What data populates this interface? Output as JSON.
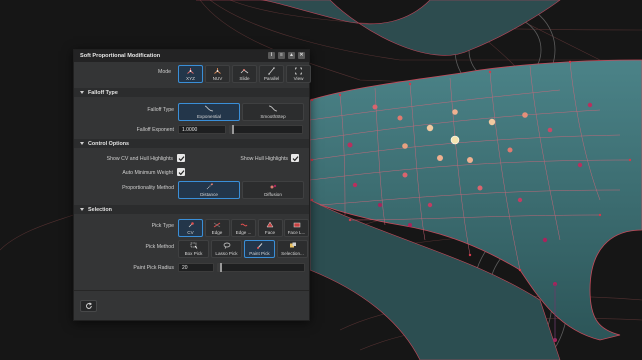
{
  "panel": {
    "title": "Soft Proportional Modification",
    "title_icons": [
      "info-icon",
      "menu-icon",
      "warning-icon",
      "close-icon"
    ]
  },
  "mode": {
    "label": "Mode",
    "options": [
      {
        "label": "XYZ",
        "icon": "xyz-axes-icon",
        "selected": true
      },
      {
        "label": "NUV",
        "icon": "nuv-axes-icon",
        "selected": false
      },
      {
        "label": "Slide",
        "icon": "slide-icon",
        "selected": false
      },
      {
        "label": "Parallel",
        "icon": "parallel-icon",
        "selected": false
      },
      {
        "label": "View",
        "icon": "view-icon",
        "selected": false
      }
    ]
  },
  "falloff": {
    "section": "Falloff Type",
    "type_label": "Falloff Type",
    "types": [
      {
        "label": "Exponential",
        "icon": "exponential-curve-icon",
        "selected": true
      },
      {
        "label": "SmoothStep",
        "icon": "smoothstep-curve-icon",
        "selected": false
      }
    ],
    "exponent_label": "Falloff Exponent",
    "exponent_value": "1.0000",
    "exponent_fraction": 0.03
  },
  "control": {
    "section": "Control Options",
    "show_cv_label": "Show CV and Hull Highlights",
    "show_cv": true,
    "show_hull_label": "Show Hull Highlights",
    "show_hull": true,
    "auto_min_label": "Auto Minimum Weight",
    "auto_min": true,
    "prop_method_label": "Proportionality Method",
    "methods": [
      {
        "label": "Distance",
        "icon": "distance-icon",
        "selected": true
      },
      {
        "label": "Diffusion",
        "icon": "diffusion-icon",
        "selected": false
      }
    ]
  },
  "selection": {
    "section": "Selection",
    "pick_type_label": "Pick Type",
    "pick_types": [
      {
        "label": "CV",
        "icon": "cv-pick-icon",
        "selected": true
      },
      {
        "label": "Edge",
        "icon": "edge-pick-icon",
        "selected": false
      },
      {
        "label": "Edge ...",
        "icon": "edge-loop-pick-icon",
        "selected": false
      },
      {
        "label": "Face",
        "icon": "face-pick-icon",
        "selected": false
      },
      {
        "label": "Face L...",
        "icon": "face-loop-pick-icon",
        "selected": false
      }
    ],
    "pick_method_label": "Pick Method",
    "pick_methods": [
      {
        "label": "Box Pick",
        "icon": "box-pick-icon",
        "selected": false
      },
      {
        "label": "Lasso Pick",
        "icon": "lasso-pick-icon",
        "selected": false
      },
      {
        "label": "Paint Pick",
        "icon": "paint-pick-icon",
        "selected": true
      },
      {
        "label": "Selection...",
        "icon": "selection-set-icon",
        "selected": false
      }
    ],
    "radius_label": "Paint Pick Radius",
    "radius_value": "20",
    "radius_fraction": 0.02
  },
  "footer": {
    "reset_icon": "reset-icon"
  },
  "colors": {
    "accent": "#3a8fd8",
    "surface": "#3c6a6e",
    "cv_hot": "#f4e3b0",
    "cv_mid": "#e07a70",
    "cv_cold": "#a8245c",
    "wire": "#c44a5a"
  }
}
